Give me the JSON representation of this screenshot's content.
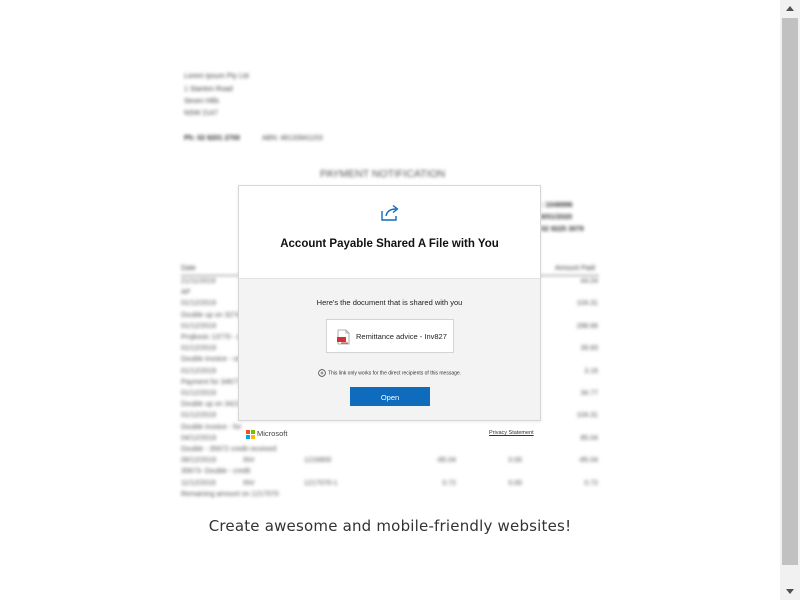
{
  "background_document": {
    "company_name": "Lorem Ipsum Pty Ltd",
    "address": [
      "1 Stanton Road",
      "Seven Hills",
      "NSW 2147"
    ],
    "phone": "Ph: 02 8201 2700",
    "abn": "ABN: 48133941153",
    "heading": "PAYMENT NOTIFICATION",
    "right_values": [
      ": 1048996",
      "8/01/2020",
      "02 9225 3079"
    ],
    "col_date": "Date",
    "col_amount": "Amount Paid",
    "rows": [
      {
        "c1": "21/11/2019",
        "c5": "44.04"
      },
      {
        "c1": "AP",
        "c5": ""
      },
      {
        "c1": "01/12/2019",
        "c5": "104.31"
      },
      {
        "c1": "Double up on 3274",
        "c5": ""
      },
      {
        "c1": "01/12/2019",
        "c5": "288.66"
      },
      {
        "c1": "Projkosic 13770 - d",
        "c5": ""
      },
      {
        "c1": "01/12/2019",
        "c5": "39.83"
      },
      {
        "c1": "Double invoice - ce",
        "c5": ""
      },
      {
        "c1": "01/12/2019",
        "c5": "3.16"
      },
      {
        "c1": "Payment for 34677",
        "c5": ""
      },
      {
        "c1": "01/12/2019",
        "c5": "34.77"
      },
      {
        "c1": "Double up on 3421",
        "c5": ""
      },
      {
        "c1": "01/12/2019",
        "c5": "104.31"
      },
      {
        "c1": "Double invoice - for",
        "c5": ""
      },
      {
        "c1": "04/12/2019",
        "c5": "85.04"
      },
      {
        "c1": "Double - 35672 credit received",
        "c5": ""
      },
      {
        "c1": "06/12/2019",
        "c2": "INV",
        "c3": "1216800",
        "c4a": "-85.04",
        "c4b": "0.00",
        "c5": "-85.04"
      },
      {
        "c1": "35673- Double - credit",
        "c5": ""
      },
      {
        "c1": "11/12/2019",
        "c2": "INV",
        "c3": "1217070-1",
        "c4a": "0.72",
        "c4b": "0.00",
        "c5": "0.72"
      },
      {
        "c1": "Remaining amount on 1217070",
        "c5": ""
      }
    ]
  },
  "modal": {
    "title": "Account Payable Shared A File with You",
    "subtitle": "Here's the document that is shared with you",
    "file_name": "Remittance advice - Inv827",
    "recipient_note": "This link only works for the direct recipients of this message.",
    "open_button": "Open",
    "accent_color": "#0f6cbd"
  },
  "footer": {
    "brand": "Microsoft",
    "privacy": "Privacy Statement"
  },
  "tagline": "Create awesome and mobile-friendly websites!"
}
